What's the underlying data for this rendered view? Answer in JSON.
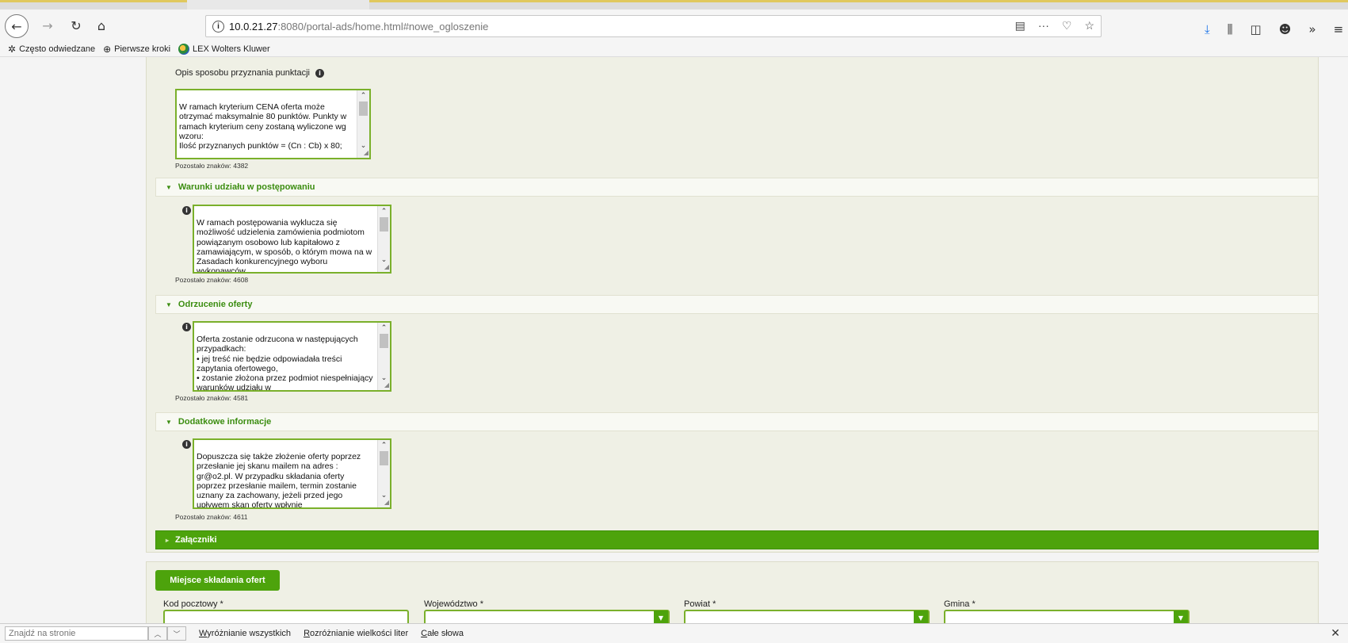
{
  "browser": {
    "url_host": "10.0.21.27",
    "url_rest": ":8080/portal-ads/home.html#nowe_ogloszenie",
    "bookmarks": [
      "Często odwiedzane",
      "Pierwsze kroki",
      "LEX Wolters Kluwer"
    ]
  },
  "form": {
    "opis_label": "Opis sposobu przyznania punktacji",
    "opis_text": "W ramach kryterium CENA oferta może otrzymać maksymalnie 80 punktów. Punkty w ramach kryterium ceny zostaną wyliczone wg wzoru:\nIlość przyznanych punktów = (Cn : Cb) x 80;",
    "opis_counter": "Pozostało znaków: 4382",
    "sections": [
      {
        "title": "Warunki udziału w postępowaniu",
        "text": "W ramach postępowania wyklucza się możliwość udzielenia zamówienia podmiotom powiązanym osobowo lub kapitałowo z zamawiającym, w sposób, o którym mowa na w Zasadach konkurencyjnego wyboru wykonawców",
        "counter": "Pozostało znaków: 4608"
      },
      {
        "title": "Odrzucenie oferty",
        "text": "Oferta zostanie odrzucona w następujących przypadkach:\n•      jej treść nie będzie odpowiadała treści zapytania ofertowego,\n•      zostanie złożona przez podmiot niespełniający warunków udziału w",
        "counter": "Pozostało znaków: 4581"
      },
      {
        "title": "Dodatkowe informacje",
        "text": "Dopuszcza się także złożenie oferty poprzez przesłanie jej skanu mailem na adres : gr@o2.pl.  W przypadku składania oferty poprzez przesłanie mailem, termin zostanie uznany za zachowany, jeżeli przed jego upływem skan oferty wpłynie",
        "counter": "Pozostało znaków: 4611"
      }
    ],
    "attachments_title": "Załączniki",
    "place_button": "Miejsce składania ofert",
    "fields": {
      "kod": "Kod pocztowy *",
      "woj": "Województwo *",
      "powiat": "Powiat *",
      "gmina": "Gmina *"
    }
  },
  "findbar": {
    "placeholder": "Znajdź na stronie",
    "highlight_all": "Wyróżnianie wszystkich",
    "highlight_all_key": "W",
    "highlight_all_rest": "yróżnianie wszystkich",
    "match_case_key": "R",
    "match_case_rest": "ozróżnianie wielkości liter",
    "whole_words_key": "C",
    "whole_words_rest": "ałe słowa"
  },
  "icons": {
    "info": "i",
    "dropdown": "▼"
  }
}
